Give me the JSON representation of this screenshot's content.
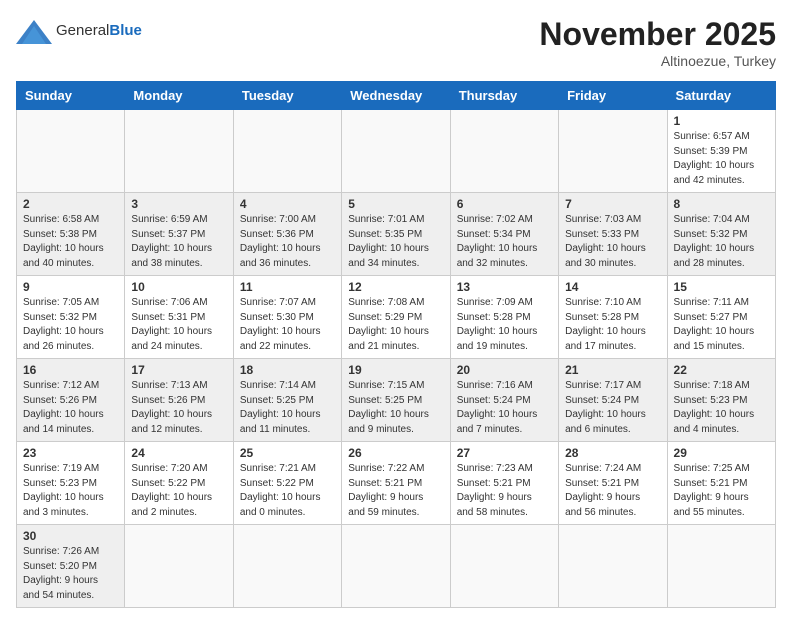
{
  "header": {
    "logo_general": "General",
    "logo_blue": "Blue",
    "month_title": "November 2025",
    "location": "Altinoezue, Turkey"
  },
  "weekdays": [
    "Sunday",
    "Monday",
    "Tuesday",
    "Wednesday",
    "Thursday",
    "Friday",
    "Saturday"
  ],
  "weeks": [
    [
      {
        "day": "",
        "info": ""
      },
      {
        "day": "",
        "info": ""
      },
      {
        "day": "",
        "info": ""
      },
      {
        "day": "",
        "info": ""
      },
      {
        "day": "",
        "info": ""
      },
      {
        "day": "",
        "info": ""
      },
      {
        "day": "1",
        "info": "Sunrise: 6:57 AM\nSunset: 5:39 PM\nDaylight: 10 hours\nand 42 minutes."
      }
    ],
    [
      {
        "day": "2",
        "info": "Sunrise: 6:58 AM\nSunset: 5:38 PM\nDaylight: 10 hours\nand 40 minutes."
      },
      {
        "day": "3",
        "info": "Sunrise: 6:59 AM\nSunset: 5:37 PM\nDaylight: 10 hours\nand 38 minutes."
      },
      {
        "day": "4",
        "info": "Sunrise: 7:00 AM\nSunset: 5:36 PM\nDaylight: 10 hours\nand 36 minutes."
      },
      {
        "day": "5",
        "info": "Sunrise: 7:01 AM\nSunset: 5:35 PM\nDaylight: 10 hours\nand 34 minutes."
      },
      {
        "day": "6",
        "info": "Sunrise: 7:02 AM\nSunset: 5:34 PM\nDaylight: 10 hours\nand 32 minutes."
      },
      {
        "day": "7",
        "info": "Sunrise: 7:03 AM\nSunset: 5:33 PM\nDaylight: 10 hours\nand 30 minutes."
      },
      {
        "day": "8",
        "info": "Sunrise: 7:04 AM\nSunset: 5:32 PM\nDaylight: 10 hours\nand 28 minutes."
      }
    ],
    [
      {
        "day": "9",
        "info": "Sunrise: 7:05 AM\nSunset: 5:32 PM\nDaylight: 10 hours\nand 26 minutes."
      },
      {
        "day": "10",
        "info": "Sunrise: 7:06 AM\nSunset: 5:31 PM\nDaylight: 10 hours\nand 24 minutes."
      },
      {
        "day": "11",
        "info": "Sunrise: 7:07 AM\nSunset: 5:30 PM\nDaylight: 10 hours\nand 22 minutes."
      },
      {
        "day": "12",
        "info": "Sunrise: 7:08 AM\nSunset: 5:29 PM\nDaylight: 10 hours\nand 21 minutes."
      },
      {
        "day": "13",
        "info": "Sunrise: 7:09 AM\nSunset: 5:28 PM\nDaylight: 10 hours\nand 19 minutes."
      },
      {
        "day": "14",
        "info": "Sunrise: 7:10 AM\nSunset: 5:28 PM\nDaylight: 10 hours\nand 17 minutes."
      },
      {
        "day": "15",
        "info": "Sunrise: 7:11 AM\nSunset: 5:27 PM\nDaylight: 10 hours\nand 15 minutes."
      }
    ],
    [
      {
        "day": "16",
        "info": "Sunrise: 7:12 AM\nSunset: 5:26 PM\nDaylight: 10 hours\nand 14 minutes."
      },
      {
        "day": "17",
        "info": "Sunrise: 7:13 AM\nSunset: 5:26 PM\nDaylight: 10 hours\nand 12 minutes."
      },
      {
        "day": "18",
        "info": "Sunrise: 7:14 AM\nSunset: 5:25 PM\nDaylight: 10 hours\nand 11 minutes."
      },
      {
        "day": "19",
        "info": "Sunrise: 7:15 AM\nSunset: 5:25 PM\nDaylight: 10 hours\nand 9 minutes."
      },
      {
        "day": "20",
        "info": "Sunrise: 7:16 AM\nSunset: 5:24 PM\nDaylight: 10 hours\nand 7 minutes."
      },
      {
        "day": "21",
        "info": "Sunrise: 7:17 AM\nSunset: 5:24 PM\nDaylight: 10 hours\nand 6 minutes."
      },
      {
        "day": "22",
        "info": "Sunrise: 7:18 AM\nSunset: 5:23 PM\nDaylight: 10 hours\nand 4 minutes."
      }
    ],
    [
      {
        "day": "23",
        "info": "Sunrise: 7:19 AM\nSunset: 5:23 PM\nDaylight: 10 hours\nand 3 minutes."
      },
      {
        "day": "24",
        "info": "Sunrise: 7:20 AM\nSunset: 5:22 PM\nDaylight: 10 hours\nand 2 minutes."
      },
      {
        "day": "25",
        "info": "Sunrise: 7:21 AM\nSunset: 5:22 PM\nDaylight: 10 hours\nand 0 minutes."
      },
      {
        "day": "26",
        "info": "Sunrise: 7:22 AM\nSunset: 5:21 PM\nDaylight: 9 hours\nand 59 minutes."
      },
      {
        "day": "27",
        "info": "Sunrise: 7:23 AM\nSunset: 5:21 PM\nDaylight: 9 hours\nand 58 minutes."
      },
      {
        "day": "28",
        "info": "Sunrise: 7:24 AM\nSunset: 5:21 PM\nDaylight: 9 hours\nand 56 minutes."
      },
      {
        "day": "29",
        "info": "Sunrise: 7:25 AM\nSunset: 5:21 PM\nDaylight: 9 hours\nand 55 minutes."
      }
    ],
    [
      {
        "day": "30",
        "info": "Sunrise: 7:26 AM\nSunset: 5:20 PM\nDaylight: 9 hours\nand 54 minutes."
      },
      {
        "day": "",
        "info": ""
      },
      {
        "day": "",
        "info": ""
      },
      {
        "day": "",
        "info": ""
      },
      {
        "day": "",
        "info": ""
      },
      {
        "day": "",
        "info": ""
      },
      {
        "day": "",
        "info": ""
      }
    ]
  ]
}
